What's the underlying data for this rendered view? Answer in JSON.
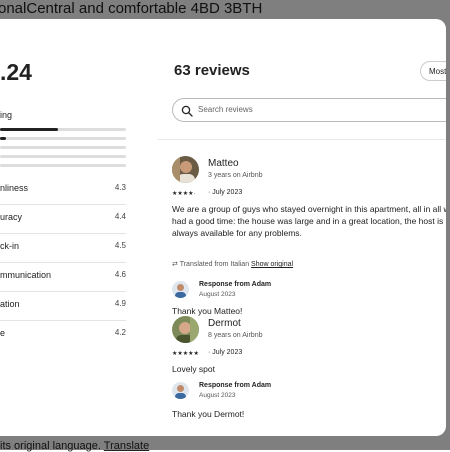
{
  "background": {
    "title": "onalCentral and comfortable 4BD 3BTH",
    "bottom_text": "its original language.",
    "bottom_link": "Translate"
  },
  "modal": {
    "rating": ".24",
    "overall_label": "ing",
    "rating_bars": [
      0.46,
      0.05,
      0.0,
      0.0,
      0.0
    ],
    "categories": [
      {
        "label": "nliness",
        "value": "4.3"
      },
      {
        "label": "uracy",
        "value": "4.4"
      },
      {
        "label": "ck-in",
        "value": "4.5"
      },
      {
        "label": "mmunication",
        "value": "4.6"
      },
      {
        "label": "ation",
        "value": "4.9"
      },
      {
        "label": "e",
        "value": "4.2"
      }
    ],
    "heading": "63 reviews",
    "sort_label": "Most re",
    "search_placeholder": "Search reviews",
    "reviews": [
      {
        "name": "Matteo",
        "meta": "3 years on Airbnb",
        "stars": "★★★★·",
        "date": "· July 2023",
        "text": "We are a group of guys who stayed overnight in this apartment, all in all we had a good time: the house was large and in a great location, the host is always available for any problems.",
        "translated": "Translated from Italian",
        "show_original": "Show original",
        "response_title": "Response from Adam",
        "response_date": "August 2023",
        "response_text": "Thank you Matteo!"
      },
      {
        "name": "Dermot",
        "meta": "8 years on Airbnb",
        "stars": "★★★★★",
        "date": "· July 2023",
        "text": "Lovely spot",
        "response_title": "Response from Adam",
        "response_date": "August 2023",
        "response_text": "Thank you Dermot!"
      }
    ]
  }
}
